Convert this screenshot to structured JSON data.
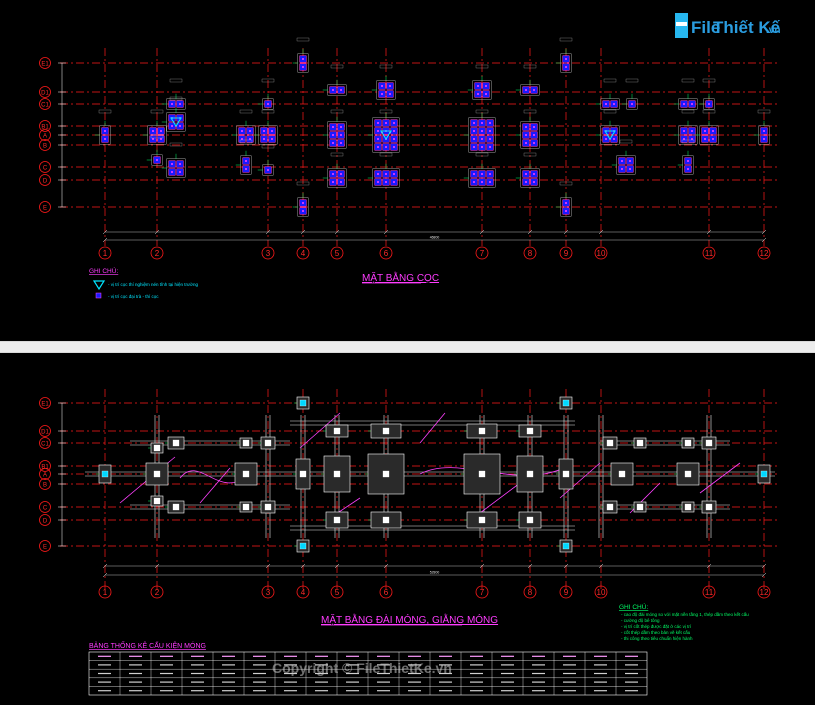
{
  "logo": {
    "part1": "File",
    "part2": "Thiết Kế",
    "domain": ".vn"
  },
  "watermark": "Copyright © FileThietKe.vn",
  "colors": {
    "grid": "#ff1a1a",
    "pile": "#1a1aff",
    "pile_edge": "#ff40ff",
    "beam": "#ff40ff",
    "dim": "#e6e6e6",
    "cap_fill": "#2a2a2a",
    "note": "#00e6ff",
    "title": "#ff3cff",
    "green": "#00ff66"
  },
  "top": {
    "title": "MẶT BẰNG CỌC",
    "note_title": "GHI CHÚ:",
    "notes": [
      "- vị trí cọc thí nghiệm nén tĩnh tại hiện trường",
      "- vị trí cọc đại trà - thí cọc"
    ],
    "overall_dim": "46800"
  },
  "bottom": {
    "title": "MẶT BẰNG ĐÀI MÓNG, GIẰNG MÓNG",
    "note_title": "GHI CHÚ:",
    "notes": [
      "- cao độ đài móng so với mặt nền tầng 1, thép dầm theo kết cấu",
      "- cường độ bê tông",
      "- vị trí cốt thép được đặt ở các vị trí",
      "- cốt thép dầm theo bản vẽ kết cấu",
      "- thi công theo tiêu chuẩn hiện hành"
    ],
    "table_title": "BẢNG THỐNG KÊ CẤU KIỆN MÓNG",
    "overall_dim": "52800"
  },
  "axes_x": [
    "1",
    "2",
    "3",
    "4",
    "5",
    "6",
    "7",
    "8",
    "9",
    "10",
    "11",
    "12"
  ],
  "axes_y": [
    "E1",
    "D1",
    "C1",
    "B1",
    "A",
    "B",
    "C",
    "D",
    "E"
  ]
}
